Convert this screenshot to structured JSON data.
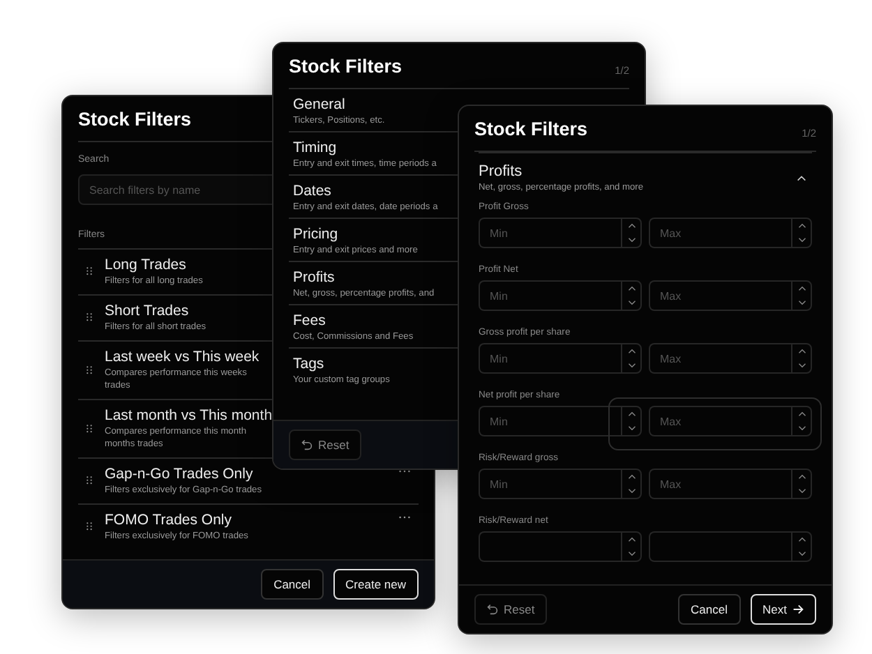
{
  "list_panel": {
    "title": "Stock Filters",
    "search": {
      "label": "Search",
      "placeholder": "Search filters by name"
    },
    "filters_label": "Filters",
    "items": [
      {
        "title": "Long Trades",
        "description": "Filters for all long trades",
        "menu": false
      },
      {
        "title": "Short Trades",
        "description": "Filters for all short trades",
        "menu": false
      },
      {
        "title": "Last week vs This week",
        "description": "Compares performance this weeks",
        "description_2": "trades",
        "menu": false
      },
      {
        "title": "Last month vs This month",
        "description": "Compares performance this month",
        "description_2": "months trades",
        "menu": false
      },
      {
        "title": "Gap-n-Go Trades Only",
        "description": "Filters exclusively for Gap-n-Go trades",
        "menu": true
      },
      {
        "title": "FOMO Trades Only",
        "description": "Filters exclusively for FOMO trades",
        "menu": true
      }
    ],
    "buttons": [
      {
        "label": "Cancel",
        "primary": false
      },
      {
        "label": "Create new",
        "primary": true
      }
    ]
  },
  "category_panel": {
    "title": "Stock Filters",
    "step": "1/2",
    "categories": [
      {
        "title": "General",
        "description": "Tickers, Positions, etc."
      },
      {
        "title": "Timing",
        "description": "Entry and exit times, time periods a"
      },
      {
        "title": "Dates",
        "description": "Entry and exit dates, date periods a"
      },
      {
        "title": "Pricing",
        "description": "Entry and exit prices and more"
      },
      {
        "title": "Profits",
        "description": "Net, gross, percentage profits, and"
      },
      {
        "title": "Fees",
        "description": "Cost, Commissions and Fees"
      },
      {
        "title": "Tags",
        "description": "Your custom tag groups"
      }
    ],
    "reset_button": "Reset"
  },
  "detail_panel": {
    "title": "Stock Filters",
    "step": "1/2",
    "section": {
      "title": "Profits",
      "description": "Net, gross, percentage profits, and more",
      "expanded": true
    },
    "rows": [
      {
        "label": "Profit Gross",
        "min_placeholder": "Min",
        "max_placeholder": "Max",
        "highlighted": false
      },
      {
        "label": "Profit Net",
        "min_placeholder": "Min",
        "max_placeholder": "Max",
        "highlighted": false
      },
      {
        "label": "Gross profit per share",
        "min_placeholder": "Min",
        "max_placeholder": "Max",
        "highlighted": false
      },
      {
        "label": "Net profit per share",
        "min_placeholder": "Min",
        "max_placeholder": "Max",
        "highlighted": true
      },
      {
        "label": "Risk/Reward gross",
        "min_placeholder": "Min",
        "max_placeholder": "Max",
        "highlighted": false
      },
      {
        "label": "Risk/Reward net",
        "highlighted": false
      }
    ],
    "reset_button": "Reset",
    "buttons": [
      {
        "label": "Cancel",
        "primary": false
      },
      {
        "label": "Next",
        "primary": true
      }
    ]
  }
}
